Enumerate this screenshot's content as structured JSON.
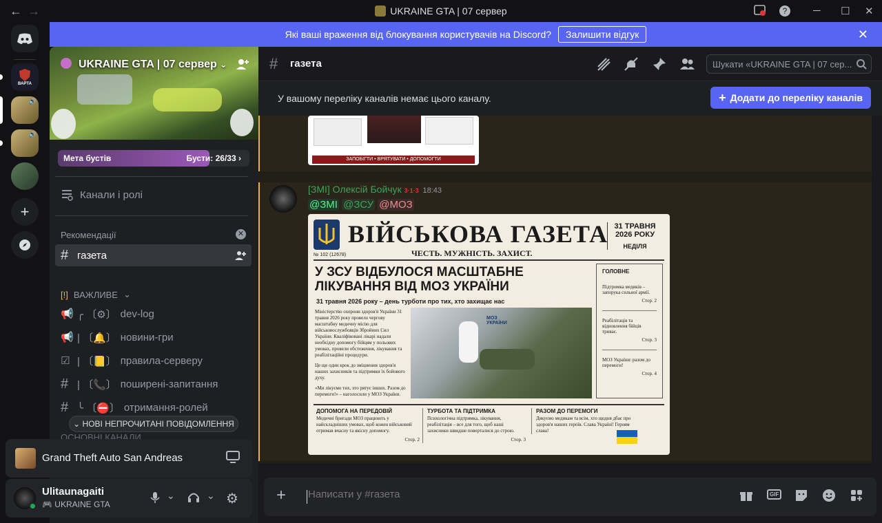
{
  "window": {
    "title": "UKRAINE GTA | 07 сервер",
    "back_icon": "←",
    "forward_icon": "→"
  },
  "banner": {
    "text": "Які ваші враження від блокування користувачів на Discord?",
    "button_label": "Залишити відгук",
    "color": "#5865f2"
  },
  "server_list": {
    "items": [
      {
        "name": "discord-home"
      },
      {
        "name": "Варта",
        "label": "ВАРТА"
      },
      {
        "name": "server-2"
      },
      {
        "name": "server-3"
      },
      {
        "name": "server-4"
      }
    ]
  },
  "sidebar": {
    "server_name": "UKRAINE GTA | 07 сервер",
    "boost_label": "Мета бустів",
    "boost_count": "Бусти: 26/33",
    "boost_progress": 0.79,
    "channels_roles": "Канали і ролі",
    "recommendations": "Рекомендації",
    "category": "ВАЖЛИВЕ",
    "category_marker": "[!]",
    "active_channel": "газета",
    "channels": [
      {
        "name": "dev-log",
        "prefix": "╭ 〔⚙〕",
        "icon": "megaphone-icon"
      },
      {
        "name": "новини-гри",
        "prefix": "| 〔🔔〕",
        "icon": "megaphone-icon"
      },
      {
        "name": "правила-серверу",
        "prefix": "| 〔📒〕",
        "icon": "rules-icon"
      },
      {
        "name": "поширені-запитання",
        "prefix": "| 〔📞〕",
        "icon": "hash-icon"
      },
      {
        "name": "отримання-ролей",
        "prefix": "╰ 〔⛔〕",
        "icon": "hash-icon"
      }
    ],
    "next_category": "ОСНОВНІ КАНАЛИ",
    "new_messages": "НОВІ НЕПРОЧИТАНІ ПОВІДОМЛЕННЯ",
    "game": "Grand Theft Auto San Andreas",
    "user": {
      "name": "Ulitaunagaiti",
      "status": "UKRAINE GTA"
    }
  },
  "channel": {
    "name": "газета",
    "search_placeholder": "Шукати «UKRAINE GTA | 07 сер...",
    "notice": "У вашому переліку каналів немає цього каналу.",
    "add_button": "Додати до переліку каналів"
  },
  "message": {
    "author": "[ЗМІ] Олексій Бойчук",
    "time": "18:43",
    "mentions": [
      "@ЗМІ",
      "@ЗСУ",
      "@МОЗ"
    ],
    "prev_embed_footer": "ЗАПОБІГТИ • ВРЯТУВАТИ • ДОПОМОГТИ"
  },
  "newspaper": {
    "title": "ВІЙСЬКОВА ГАЗЕТА",
    "motto": "ЧЕСТЬ. МУЖНІСТЬ. ЗАХИСТ.",
    "date_line1": "31 ТРАВНЯ",
    "date_line2": "2026 РОКУ",
    "weekday": "НЕДІЛЯ",
    "issue": "№ 102 (12678)",
    "headline": "У ЗСУ ВІДБУЛОСЯ МАСШТАБНЕ ЛІКУВАННЯ ВІД МОЗ УКРАЇНИ",
    "subhead": "31 травня 2026 року – день турботи про тих, хто захищає нас",
    "body1": "Міністерство охорони здоров'я України 31 травня 2026 року провело чергову масштабну медичну місію для військовослужбовців Збройних Сил України. Кваліфіковані лікарі надали необхідну допомогу бійцям у польових умовах, провели обстеження, лікування та реабілітаційні процедури.",
    "body2": "Це ще один крок до зміцнення здоров'я наших захисників та підтримки їх бойового духу.",
    "body3": "«Ми лікуємо тих, хто рятує інших. Разом до перемоги!» – наголосили у МОЗ України.",
    "photo_label": "МОЗ УКРАЇНИ",
    "side_title": "ГОЛОВНЕ",
    "side_items": [
      {
        "text": "Підтримка медиків – запорука сильної армії.",
        "page": "Стор. 2"
      },
      {
        "text": "Реабілітація та відновлення бійців триває.",
        "page": "Стор. 3"
      },
      {
        "text": "МОЗ України: разом до перемоги!",
        "page": "Стор. 4"
      }
    ],
    "bottom": [
      {
        "title": "ДОПОМОГА НА ПЕРЕДОВІЙ",
        "text": "Медичні бригади МОЗ працюють у найскладніших умовах, щоб кожен військовий отримав вчасну та якісну допомогу.",
        "page": "Стор. 2"
      },
      {
        "title": "ТУРБОТА ТА ПІДТРИМКА",
        "text": "Психологічна підтримка, лікування, реабілітація – все для того, щоб наші захисники швидше поверталися до строю.",
        "page": "Стор. 3"
      },
      {
        "title": "РАЗОМ ДО ПЕРЕМОГИ",
        "text": "Дякуємо медикам та всім, хто щодня дбає про здоров'я наших героїв. Слава Україні! Героям слава!",
        "page": ""
      }
    ]
  },
  "input": {
    "placeholder": "Написати у #газета"
  }
}
